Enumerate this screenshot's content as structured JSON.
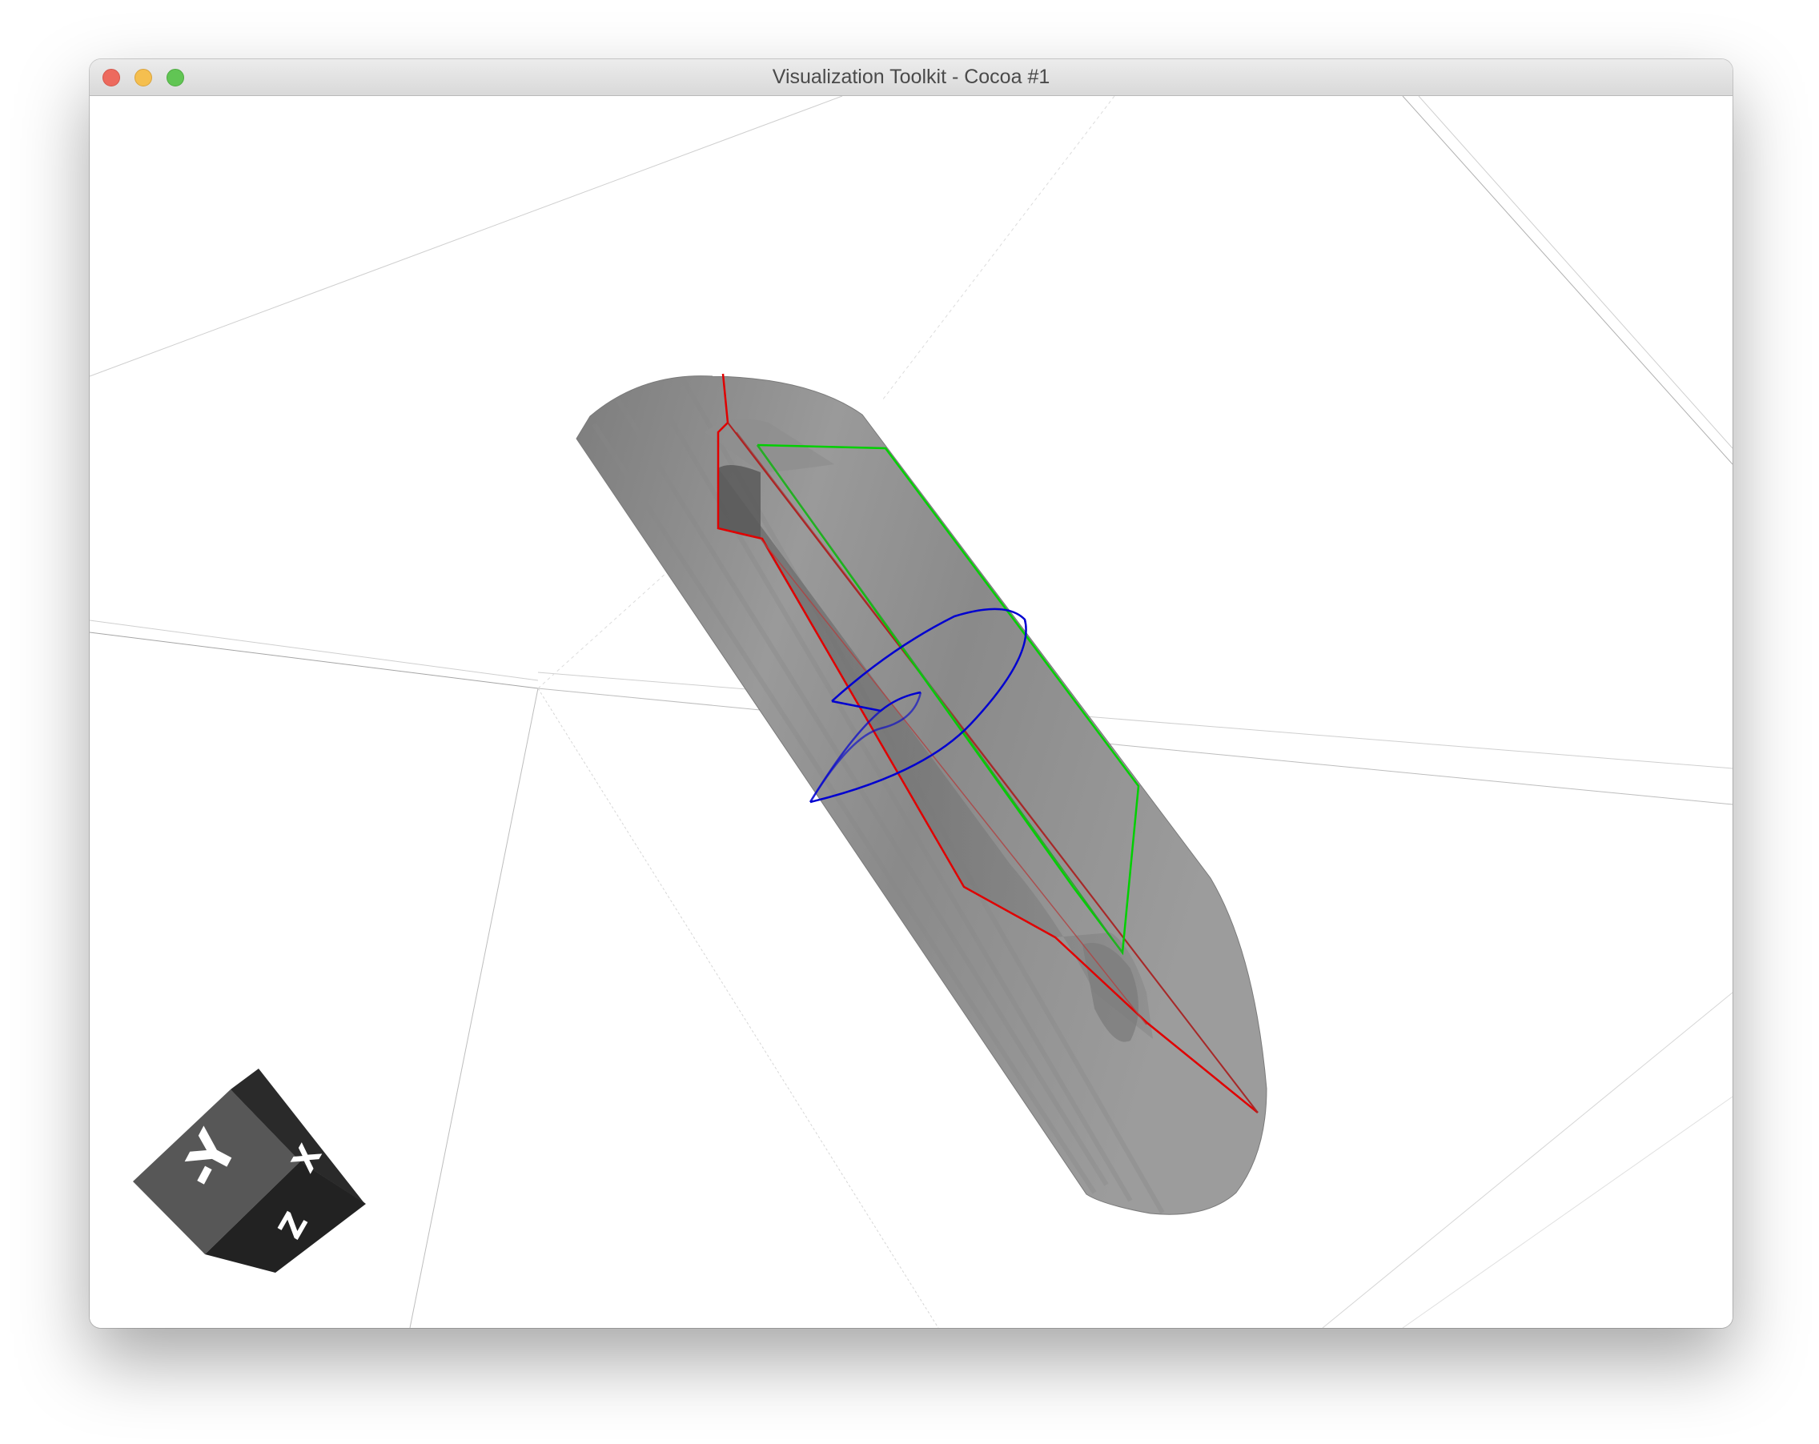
{
  "window": {
    "title": "Visualization Toolkit - Cocoa #1"
  },
  "orientation_cube": {
    "face_front": "-Y",
    "face_right": "X",
    "face_bottom": "Z"
  },
  "colors": {
    "background": "#ffffff",
    "solid": "#8c8c8c",
    "edge_red": "#e00000",
    "edge_green": "#00d000",
    "edge_blue": "#0000d0",
    "cube": "#3a3a3a"
  }
}
